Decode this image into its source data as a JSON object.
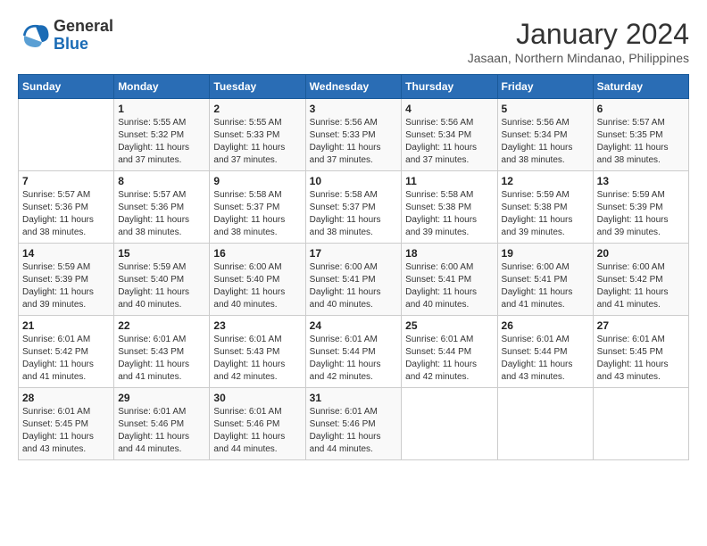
{
  "header": {
    "logo_general": "General",
    "logo_blue": "Blue",
    "month": "January 2024",
    "location": "Jasaan, Northern Mindanao, Philippines"
  },
  "days_of_week": [
    "Sunday",
    "Monday",
    "Tuesday",
    "Wednesday",
    "Thursday",
    "Friday",
    "Saturday"
  ],
  "weeks": [
    [
      {
        "day": "",
        "sunrise": "",
        "sunset": "",
        "daylight": ""
      },
      {
        "day": "1",
        "sunrise": "Sunrise: 5:55 AM",
        "sunset": "Sunset: 5:32 PM",
        "daylight": "Daylight: 11 hours and 37 minutes."
      },
      {
        "day": "2",
        "sunrise": "Sunrise: 5:55 AM",
        "sunset": "Sunset: 5:33 PM",
        "daylight": "Daylight: 11 hours and 37 minutes."
      },
      {
        "day": "3",
        "sunrise": "Sunrise: 5:56 AM",
        "sunset": "Sunset: 5:33 PM",
        "daylight": "Daylight: 11 hours and 37 minutes."
      },
      {
        "day": "4",
        "sunrise": "Sunrise: 5:56 AM",
        "sunset": "Sunset: 5:34 PM",
        "daylight": "Daylight: 11 hours and 37 minutes."
      },
      {
        "day": "5",
        "sunrise": "Sunrise: 5:56 AM",
        "sunset": "Sunset: 5:34 PM",
        "daylight": "Daylight: 11 hours and 38 minutes."
      },
      {
        "day": "6",
        "sunrise": "Sunrise: 5:57 AM",
        "sunset": "Sunset: 5:35 PM",
        "daylight": "Daylight: 11 hours and 38 minutes."
      }
    ],
    [
      {
        "day": "7",
        "sunrise": "Sunrise: 5:57 AM",
        "sunset": "Sunset: 5:36 PM",
        "daylight": "Daylight: 11 hours and 38 minutes."
      },
      {
        "day": "8",
        "sunrise": "Sunrise: 5:57 AM",
        "sunset": "Sunset: 5:36 PM",
        "daylight": "Daylight: 11 hours and 38 minutes."
      },
      {
        "day": "9",
        "sunrise": "Sunrise: 5:58 AM",
        "sunset": "Sunset: 5:37 PM",
        "daylight": "Daylight: 11 hours and 38 minutes."
      },
      {
        "day": "10",
        "sunrise": "Sunrise: 5:58 AM",
        "sunset": "Sunset: 5:37 PM",
        "daylight": "Daylight: 11 hours and 38 minutes."
      },
      {
        "day": "11",
        "sunrise": "Sunrise: 5:58 AM",
        "sunset": "Sunset: 5:38 PM",
        "daylight": "Daylight: 11 hours and 39 minutes."
      },
      {
        "day": "12",
        "sunrise": "Sunrise: 5:59 AM",
        "sunset": "Sunset: 5:38 PM",
        "daylight": "Daylight: 11 hours and 39 minutes."
      },
      {
        "day": "13",
        "sunrise": "Sunrise: 5:59 AM",
        "sunset": "Sunset: 5:39 PM",
        "daylight": "Daylight: 11 hours and 39 minutes."
      }
    ],
    [
      {
        "day": "14",
        "sunrise": "Sunrise: 5:59 AM",
        "sunset": "Sunset: 5:39 PM",
        "daylight": "Daylight: 11 hours and 39 minutes."
      },
      {
        "day": "15",
        "sunrise": "Sunrise: 5:59 AM",
        "sunset": "Sunset: 5:40 PM",
        "daylight": "Daylight: 11 hours and 40 minutes."
      },
      {
        "day": "16",
        "sunrise": "Sunrise: 6:00 AM",
        "sunset": "Sunset: 5:40 PM",
        "daylight": "Daylight: 11 hours and 40 minutes."
      },
      {
        "day": "17",
        "sunrise": "Sunrise: 6:00 AM",
        "sunset": "Sunset: 5:41 PM",
        "daylight": "Daylight: 11 hours and 40 minutes."
      },
      {
        "day": "18",
        "sunrise": "Sunrise: 6:00 AM",
        "sunset": "Sunset: 5:41 PM",
        "daylight": "Daylight: 11 hours and 40 minutes."
      },
      {
        "day": "19",
        "sunrise": "Sunrise: 6:00 AM",
        "sunset": "Sunset: 5:41 PM",
        "daylight": "Daylight: 11 hours and 41 minutes."
      },
      {
        "day": "20",
        "sunrise": "Sunrise: 6:00 AM",
        "sunset": "Sunset: 5:42 PM",
        "daylight": "Daylight: 11 hours and 41 minutes."
      }
    ],
    [
      {
        "day": "21",
        "sunrise": "Sunrise: 6:01 AM",
        "sunset": "Sunset: 5:42 PM",
        "daylight": "Daylight: 11 hours and 41 minutes."
      },
      {
        "day": "22",
        "sunrise": "Sunrise: 6:01 AM",
        "sunset": "Sunset: 5:43 PM",
        "daylight": "Daylight: 11 hours and 41 minutes."
      },
      {
        "day": "23",
        "sunrise": "Sunrise: 6:01 AM",
        "sunset": "Sunset: 5:43 PM",
        "daylight": "Daylight: 11 hours and 42 minutes."
      },
      {
        "day": "24",
        "sunrise": "Sunrise: 6:01 AM",
        "sunset": "Sunset: 5:44 PM",
        "daylight": "Daylight: 11 hours and 42 minutes."
      },
      {
        "day": "25",
        "sunrise": "Sunrise: 6:01 AM",
        "sunset": "Sunset: 5:44 PM",
        "daylight": "Daylight: 11 hours and 42 minutes."
      },
      {
        "day": "26",
        "sunrise": "Sunrise: 6:01 AM",
        "sunset": "Sunset: 5:44 PM",
        "daylight": "Daylight: 11 hours and 43 minutes."
      },
      {
        "day": "27",
        "sunrise": "Sunrise: 6:01 AM",
        "sunset": "Sunset: 5:45 PM",
        "daylight": "Daylight: 11 hours and 43 minutes."
      }
    ],
    [
      {
        "day": "28",
        "sunrise": "Sunrise: 6:01 AM",
        "sunset": "Sunset: 5:45 PM",
        "daylight": "Daylight: 11 hours and 43 minutes."
      },
      {
        "day": "29",
        "sunrise": "Sunrise: 6:01 AM",
        "sunset": "Sunset: 5:46 PM",
        "daylight": "Daylight: 11 hours and 44 minutes."
      },
      {
        "day": "30",
        "sunrise": "Sunrise: 6:01 AM",
        "sunset": "Sunset: 5:46 PM",
        "daylight": "Daylight: 11 hours and 44 minutes."
      },
      {
        "day": "31",
        "sunrise": "Sunrise: 6:01 AM",
        "sunset": "Sunset: 5:46 PM",
        "daylight": "Daylight: 11 hours and 44 minutes."
      },
      {
        "day": "",
        "sunrise": "",
        "sunset": "",
        "daylight": ""
      },
      {
        "day": "",
        "sunrise": "",
        "sunset": "",
        "daylight": ""
      },
      {
        "day": "",
        "sunrise": "",
        "sunset": "",
        "daylight": ""
      }
    ]
  ]
}
